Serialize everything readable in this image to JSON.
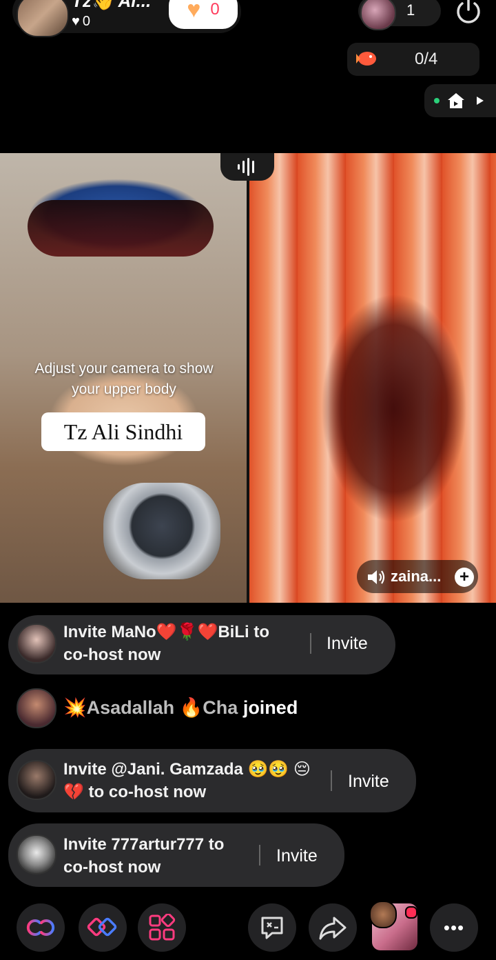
{
  "header": {
    "host_name": "Tz👋 Al...",
    "host_likes": "0",
    "follow_count": "0",
    "viewer_count": "1"
  },
  "goal": {
    "progress": "0/4"
  },
  "stage": {
    "camera_hint": "Adjust your camera to show your upper body",
    "host_tag": "Tz Ali Sindhi",
    "guest_name": "zaina...",
    "guest_add": "+"
  },
  "chat": {
    "invites": [
      {
        "text": "Invite MaNo❤️🌹❤️BiLi to co-host now",
        "button": "Invite"
      },
      {
        "text": "Invite @Jani. Gamzada 🥹🥹 😔💔 to co-host now",
        "button": "Invite"
      },
      {
        "text": "Invite 777artur777 to co-host now",
        "button": "Invite"
      }
    ],
    "join": {
      "name": "💥Asadallah 🔥Cha",
      "action": "joined"
    }
  },
  "bottom_bar": {
    "more_label": "•••"
  },
  "colors": {
    "accent_pink": "#ff3b7f",
    "accent_blue": "#4a7cff",
    "card_bg": "#2b2b2d"
  }
}
